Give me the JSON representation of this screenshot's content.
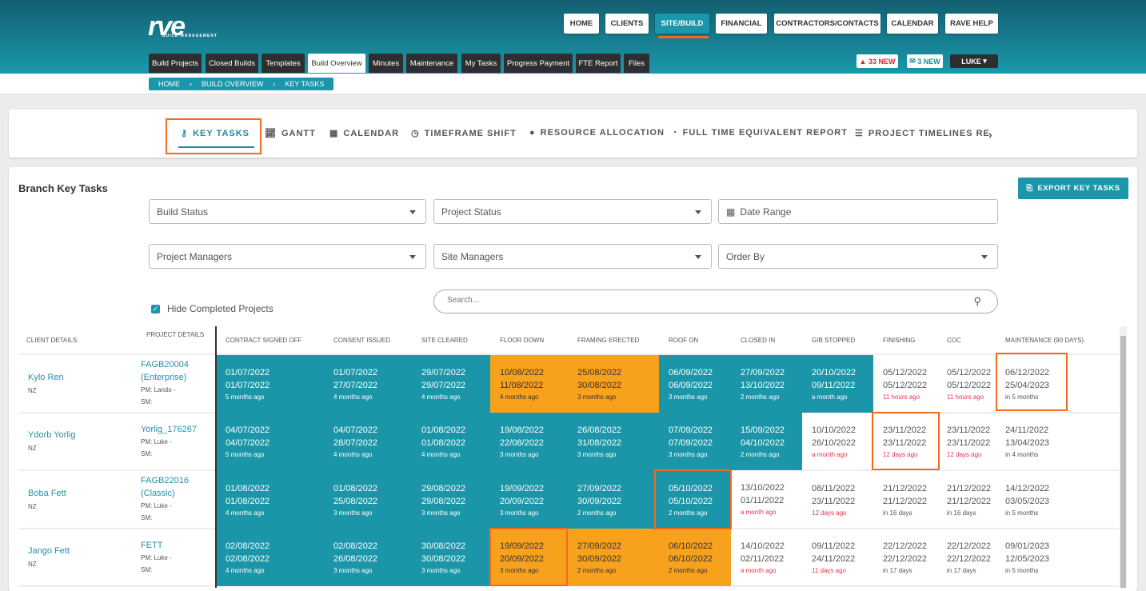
{
  "brand": {
    "logo": "rve",
    "tagline": "BUILD MANAGEMENT"
  },
  "nav": [
    "HOME",
    "CLIENTS",
    "SITE/BUILD",
    "FINANCIAL",
    "CONTRACTORS/CONTACTS",
    "CALENDAR",
    "RAVE HELP"
  ],
  "subnav": [
    "Build Projects",
    "Closed Builds",
    "Templates",
    "Build Overview",
    "Minutes",
    "Maintenance",
    "My Tasks",
    "Progress Payment",
    "FTE Report",
    "Files"
  ],
  "alerts": {
    "warnings": "33 NEW",
    "messages": "3 NEW",
    "user": "LUKE"
  },
  "breadcrumb": [
    "HOME",
    "BUILD OVERVIEW",
    "KEY TASKS"
  ],
  "tabs": [
    "KEY TASKS",
    "GANTT",
    "CALENDAR",
    "TIMEFRAME SHIFT",
    "RESOURCE ALLOCATION",
    "FULL TIME EQUIVALENT REPORT",
    "PROJECT TIMELINES RE"
  ],
  "panel": {
    "title": "Branch Key Tasks",
    "export": "EXPORT KEY TASKS",
    "hide_completed": "Hide Completed Projects",
    "search_placeholder": "Search..."
  },
  "filters": [
    "Build Status",
    "Project Status",
    "Date Range",
    "Project Managers",
    "Site Managers",
    "Order By"
  ],
  "columns": [
    "CLIENT DETAILS",
    "PROJECT DETAILS",
    "CONTRACT SIGNED OFF",
    "CONSENT ISSUED",
    "SITE CLEARED",
    "FLOOR DOWN",
    "FRAMING ERECTED",
    "ROOF ON",
    "CLOSED IN",
    "GIB STOPPED",
    "FINISHING",
    "COC",
    "MAINTENANCE (90 DAYS)"
  ],
  "colors": {
    "teal": "#1a96a8",
    "orange": "#f8a11c",
    "highlight": "#f26b1d"
  },
  "rows": [
    {
      "client": "Kylo Ren",
      "country": "NZ",
      "project": [
        "FAGB20004",
        "(Enterprise)"
      ],
      "pm": "PM: Lando -",
      "sm": "SM:",
      "cells": [
        [
          "01/07/2022",
          "01/07/2022",
          "5 months ago",
          "t"
        ],
        [
          "01/07/2022",
          "27/07/2022",
          "4 months ago",
          "t"
        ],
        [
          "29/07/2022",
          "29/07/2022",
          "4 months ago",
          "t"
        ],
        [
          "10/08/2022",
          "11/08/2022",
          "4 months ago",
          "o"
        ],
        [
          "25/08/2022",
          "30/08/2022",
          "3 months ago",
          "o"
        ],
        [
          "06/09/2022",
          "06/09/2022",
          "3 months ago",
          "t"
        ],
        [
          "27/09/2022",
          "13/10/2022",
          "2 months ago",
          "t"
        ],
        [
          "20/10/2022",
          "09/11/2022",
          "a month ago",
          "t"
        ],
        [
          "05/12/2022",
          "05/12/2022",
          "11 hours ago",
          "w"
        ],
        [
          "05/12/2022",
          "05/12/2022",
          "11 hours ago",
          "w"
        ],
        [
          "06/12/2022",
          "25/04/2023",
          "in 5 months",
          "w"
        ]
      ]
    },
    {
      "client": "Ydorb Yorlig",
      "country": "NZ",
      "project": [
        "Yorlig_176267"
      ],
      "pm": "PM: Luke -",
      "sm": "SM:",
      "cells": [
        [
          "04/07/2022",
          "04/07/2022",
          "5 months ago",
          "t"
        ],
        [
          "04/07/2022",
          "28/07/2022",
          "4 months ago",
          "t"
        ],
        [
          "01/08/2022",
          "01/08/2022",
          "4 months ago",
          "t"
        ],
        [
          "19/08/2022",
          "22/08/2022",
          "3 months ago",
          "t"
        ],
        [
          "26/08/2022",
          "31/08/2022",
          "3 months ago",
          "t"
        ],
        [
          "07/09/2022",
          "07/09/2022",
          "3 months ago",
          "t"
        ],
        [
          "15/09/2022",
          "04/10/2022",
          "2 months ago",
          "t"
        ],
        [
          "10/10/2022",
          "26/10/2022",
          "a month ago",
          "w"
        ],
        [
          "23/11/2022",
          "23/11/2022",
          "12 days ago",
          "w"
        ],
        [
          "23/11/2022",
          "23/11/2022",
          "12 days ago",
          "w"
        ],
        [
          "24/11/2022",
          "13/04/2023",
          "in 4 months",
          "w"
        ]
      ]
    },
    {
      "client": "Boba Fett",
      "country": "NZ",
      "project": [
        "FAGB22016",
        "(Classic)"
      ],
      "pm": "PM: Luke -",
      "sm": "SM:",
      "cells": [
        [
          "01/08/2022",
          "01/08/2022",
          "4 months ago",
          "t"
        ],
        [
          "01/08/2022",
          "25/08/2022",
          "3 months ago",
          "t"
        ],
        [
          "29/08/2022",
          "29/08/2022",
          "3 months ago",
          "t"
        ],
        [
          "19/09/2022",
          "20/09/2022",
          "3 months ago",
          "t"
        ],
        [
          "27/09/2022",
          "30/09/2022",
          "2 months ago",
          "t"
        ],
        [
          "05/10/2022",
          "05/10/2022",
          "2 months ago",
          "t"
        ],
        [
          "13/10/2022",
          "01/11/2022",
          "a month ago",
          "w"
        ],
        [
          "08/11/2022",
          "23/11/2022",
          "12 days ago",
          "w"
        ],
        [
          "21/12/2022",
          "21/12/2022",
          "in 16 days",
          "w"
        ],
        [
          "21/12/2022",
          "21/12/2022",
          "in 16 days",
          "w"
        ],
        [
          "14/12/2022",
          "03/05/2023",
          "in 5 months",
          "w"
        ]
      ]
    },
    {
      "client": "Jango Fett",
      "country": "NZ",
      "project": [
        "FETT"
      ],
      "pm": "PM: Luke -",
      "sm": "SM:",
      "cells": [
        [
          "02/08/2022",
          "02/08/2022",
          "4 months ago",
          "t"
        ],
        [
          "02/08/2022",
          "26/08/2022",
          "3 months ago",
          "t"
        ],
        [
          "30/08/2022",
          "30/08/2022",
          "3 months ago",
          "t"
        ],
        [
          "19/09/2022",
          "20/09/2022",
          "3 months ago",
          "o"
        ],
        [
          "27/09/2022",
          "30/09/2022",
          "2 months ago",
          "o"
        ],
        [
          "06/10/2022",
          "06/10/2022",
          "2 months ago",
          "o"
        ],
        [
          "14/10/2022",
          "02/11/2022",
          "a month ago",
          "w"
        ],
        [
          "09/11/2022",
          "24/11/2022",
          "11 days ago",
          "w"
        ],
        [
          "22/12/2022",
          "22/12/2022",
          "in 17 days",
          "w"
        ],
        [
          "22/12/2022",
          "22/12/2022",
          "in 17 days",
          "w"
        ],
        [
          "09/01/2023",
          "12/05/2023",
          "in 5 months",
          "w"
        ]
      ]
    }
  ]
}
